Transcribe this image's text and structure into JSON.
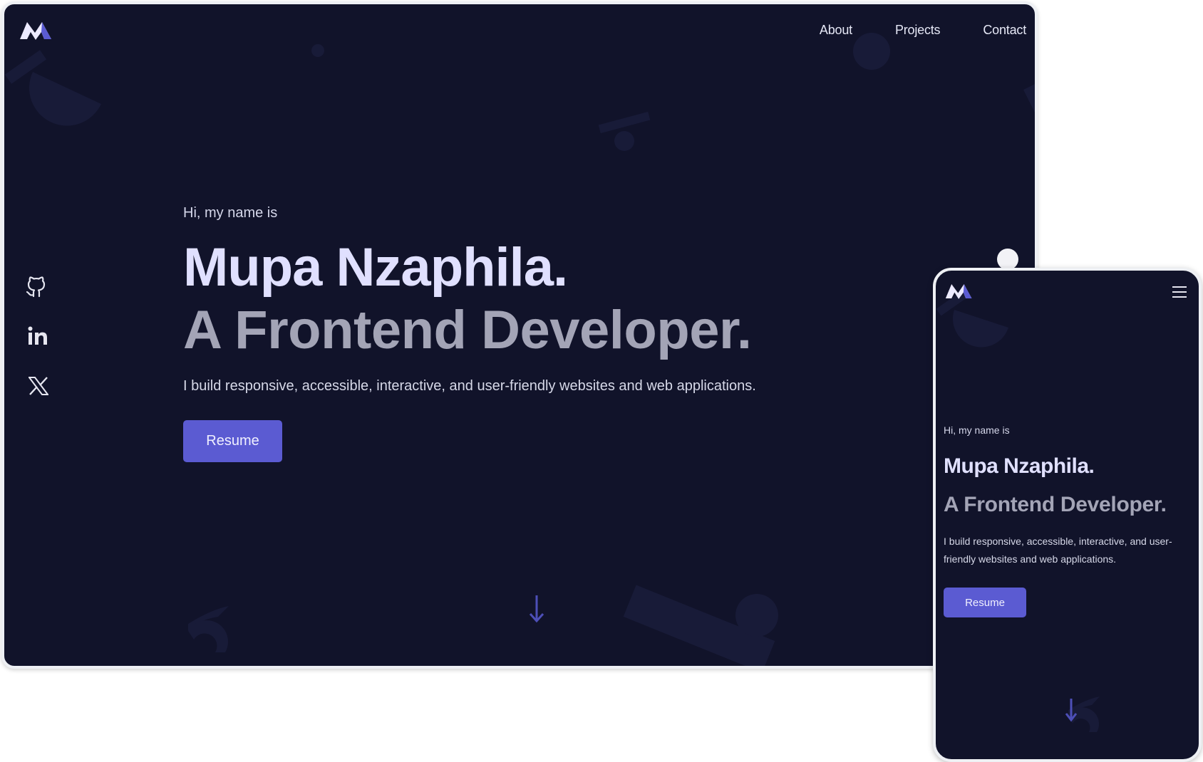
{
  "desktop": {
    "nav": {
      "about": "About",
      "projects": "Projects",
      "contact": "Contact"
    },
    "social": [
      "github-icon",
      "linkedin-icon",
      "x-twitter-icon"
    ],
    "hero": {
      "greeting": "Hi, my name is",
      "name": "Mupa Nzaphila.",
      "role": "A Frontend Developer.",
      "description": "I build responsive, accessible, interactive, and user-friendly websites and web applications.",
      "button": "Resume"
    }
  },
  "mobile": {
    "hero": {
      "greeting": "Hi, my name is",
      "name": "Mupa Nzaphila.",
      "role": "A Frontend Developer.",
      "description_line1": "I build responsive, accessible, interactive, and user-",
      "description_line2": "friendly websites and web applications.",
      "button": "Resume"
    }
  },
  "colors": {
    "background": "#11132a",
    "accent": "#5b5bd2",
    "name": "#e0e0ff",
    "role": "#a3a4b6"
  }
}
